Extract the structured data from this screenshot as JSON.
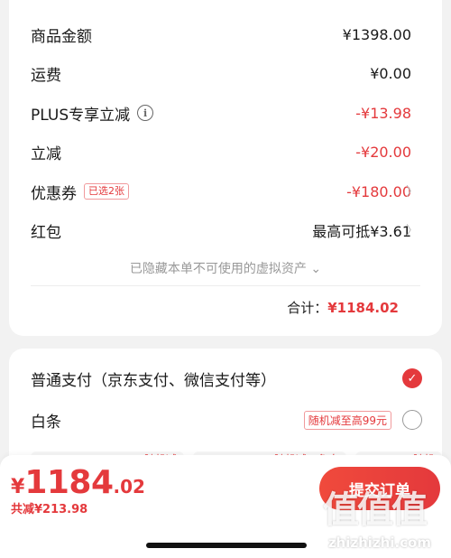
{
  "summary": {
    "goods_amount_label": "商品金额",
    "goods_amount_value": "¥1398.00",
    "shipping_label": "运费",
    "shipping_value": "¥0.00",
    "plus_label": "PLUS专享立减",
    "plus_value": "-¥13.98",
    "instant_label": "立减",
    "instant_value": "-¥20.00",
    "coupon_label": "优惠券",
    "coupon_tag": "已选2张",
    "coupon_value": "-¥180.00",
    "redpacket_label": "红包",
    "redpacket_value": "最高可抵¥3.61",
    "hidden_note": "已隐藏本单不可使用的虚拟资产 ⌄",
    "total_label": "合计：",
    "total_value": "¥1184.02"
  },
  "payment": {
    "normal_label": "普通支付（京东支付、微信支付等）",
    "baitiao_label": "白条",
    "baitiao_promo": "随机减至高99元",
    "plan1_tag": "随机减",
    "plan2_tag": "随机减＋免息",
    "plan3_tag": "随机"
  },
  "bottom": {
    "yen": "¥",
    "price_int": "1184",
    "price_dec": ".02",
    "saved": "共减¥213.98",
    "submit": "提交订单"
  },
  "watermark": {
    "text": "值值值",
    "url": "zhizhizhi.com"
  },
  "colors": {
    "accent": "#e4393c",
    "background": "#f2f2f2"
  },
  "icons": {
    "info": "info-circle-icon",
    "chevron": "chevron-right-icon",
    "check": "check-circle-icon"
  }
}
